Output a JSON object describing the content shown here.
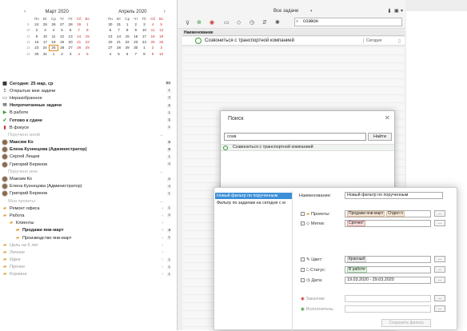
{
  "calendar": {
    "months": [
      {
        "title": "Март 2020",
        "weekdays": [
          "Пн",
          "Вт",
          "Ср",
          "Чт",
          "Пт",
          "Сб",
          "Вс"
        ],
        "weeks": [
          {
            "wk": "9",
            "days": [
              "24",
              "25",
              "26",
              "27",
              "28",
              "29",
              "1"
            ]
          },
          {
            "wk": "10",
            "days": [
              "2",
              "3",
              "4",
              "5",
              "6",
              "7",
              "8"
            ]
          },
          {
            "wk": "11",
            "days": [
              "9",
              "10",
              "11",
              "12",
              "13",
              "14",
              "15"
            ]
          },
          {
            "wk": "12",
            "days": [
              "16",
              "17",
              "18",
              "19",
              "20",
              "21",
              "22"
            ]
          },
          {
            "wk": "13",
            "days": [
              "23",
              "24",
              "25",
              "26",
              "27",
              "28",
              "29"
            ]
          },
          {
            "wk": "14",
            "days": [
              "30",
              "31",
              "1",
              "2",
              "3",
              "4",
              "5"
            ]
          }
        ],
        "today": "25"
      },
      {
        "title": "Апрель 2020",
        "weekdays": [
          "Пн",
          "Вт",
          "Ср",
          "Чт",
          "Пт",
          "Сб",
          "Вс"
        ],
        "weeks": [
          {
            "wk": "",
            "days": [
              "30",
              "31",
              "1",
              "2",
              "3",
              "4",
              "5"
            ]
          },
          {
            "wk": "",
            "days": [
              "6",
              "7",
              "8",
              "9",
              "10",
              "11",
              "12"
            ]
          },
          {
            "wk": "",
            "days": [
              "13",
              "14",
              "15",
              "16",
              "17",
              "18",
              "19"
            ]
          },
          {
            "wk": "",
            "days": [
              "20",
              "21",
              "22",
              "23",
              "24",
              "25",
              "26"
            ]
          },
          {
            "wk": "",
            "days": [
              "27",
              "28",
              "29",
              "30",
              "1",
              "2",
              "3"
            ]
          },
          {
            "wk": "",
            "days": [
              "4",
              "5",
              "6",
              "7",
              "8",
              "9",
              "10"
            ]
          }
        ]
      }
    ]
  },
  "sidebar": {
    "items": [
      {
        "label": "Сегодня: 25 мар, ср",
        "count": "50",
        "icon": "calendar-icon",
        "bold": true
      },
      {
        "label": "Открытые мне задачи",
        "count": "1",
        "icon": "share-icon",
        "bold": false
      },
      {
        "label": "Неразобранное",
        "count": "2",
        "icon": "inbox-icon",
        "bold": false
      },
      {
        "label": "Непрочитанные задачи",
        "count": "1",
        "icon": "mail-icon",
        "bold": true
      },
      {
        "label": "В работе",
        "count": "1",
        "icon": "play-icon",
        "bold": false
      },
      {
        "label": "Готово к сдаче",
        "count": "1",
        "icon": "check-icon",
        "bold": true
      },
      {
        "label": "В фокусе",
        "count": "1",
        "icon": "bookmark-icon",
        "bold": false
      }
    ],
    "section_assigned_by_me": "Поручено мной",
    "assigned_by_me": [
      {
        "label": "Максим Ко",
        "count": "5",
        "bold": true
      },
      {
        "label": "Елена Кузнецова (Администратор)",
        "count": "5",
        "bold": true
      },
      {
        "label": "Сергей Лещев",
        "count": "1",
        "bold": false
      },
      {
        "label": "Григорий Беринов",
        "count": "2",
        "bold": false
      }
    ],
    "section_assigned_to_me": "Поручено мне",
    "assigned_to_me": [
      {
        "label": "Максим Ко",
        "count": "6"
      },
      {
        "label": "Елена Кузнецова (Администратор)",
        "count": "4"
      },
      {
        "label": "Григорий Беринов",
        "count": "1"
      }
    ],
    "section_projects": "Мои проекты",
    "projects": [
      {
        "label": "Ремонт офиса",
        "count": "1",
        "indent": 0,
        "bold": false
      },
      {
        "label": "Работа",
        "count": "2",
        "indent": 0,
        "bold": false
      },
      {
        "label": "Клиенты",
        "count": "",
        "indent": 1,
        "bold": false
      },
      {
        "label": "Продажи янв-март",
        "count": "3",
        "indent": 2,
        "bold": true
      },
      {
        "label": "Производство янв-март",
        "count": "1",
        "indent": 2,
        "bold": false
      },
      {
        "label": "Цель на 5 лет",
        "count": "",
        "indent": 0,
        "bold": false
      },
      {
        "label": "Личное",
        "count": "",
        "indent": 0,
        "bold": false
      },
      {
        "label": "Идеи",
        "count": "1",
        "indent": 0,
        "bold": false
      },
      {
        "label": "Прочее",
        "count": "1",
        "indent": 0,
        "bold": false
      },
      {
        "label": "Корзина",
        "count": "1",
        "indent": 0,
        "bold": false
      }
    ]
  },
  "main": {
    "view_title": "Все задачи",
    "search_value": "созвон",
    "column_header": "Наименование",
    "task_title": "Созвониться с транспортной компанией",
    "task_date_label": "Сегодня"
  },
  "search_dialog": {
    "title": "Поиск",
    "query": "созв",
    "find_button": "Найти",
    "result": "Созвониться с транспортной компанией"
  },
  "filter_dialog": {
    "list": [
      "Новый фильтр по порученным",
      "Фильтр по задачам на сегодня с м"
    ],
    "name_label": "Наименование:",
    "name_value": "Новый фильтр по порученным",
    "projects_label": "Проекты:",
    "projects_tags": [
      "Продажи янв-март",
      "Отдел п"
    ],
    "tags_label": "Метки:",
    "tags_tags": [
      "Срочно!"
    ],
    "color_label": "Цвет:",
    "color_value": "Красный",
    "status_label": "Статус:",
    "status_value": "В работе",
    "date_label": "Дата:",
    "date_value": "19.03.2020 - 29.03.2020",
    "customer_label": "Заказчик:",
    "executor_label": "Исполнитель:",
    "save_button": "Сохранить фильтр",
    "more_button": "..."
  },
  "colors": {
    "accent": "#e08a1a",
    "selection": "#3d8fd8",
    "green": "#3a9a3a",
    "red": "#c33333"
  }
}
